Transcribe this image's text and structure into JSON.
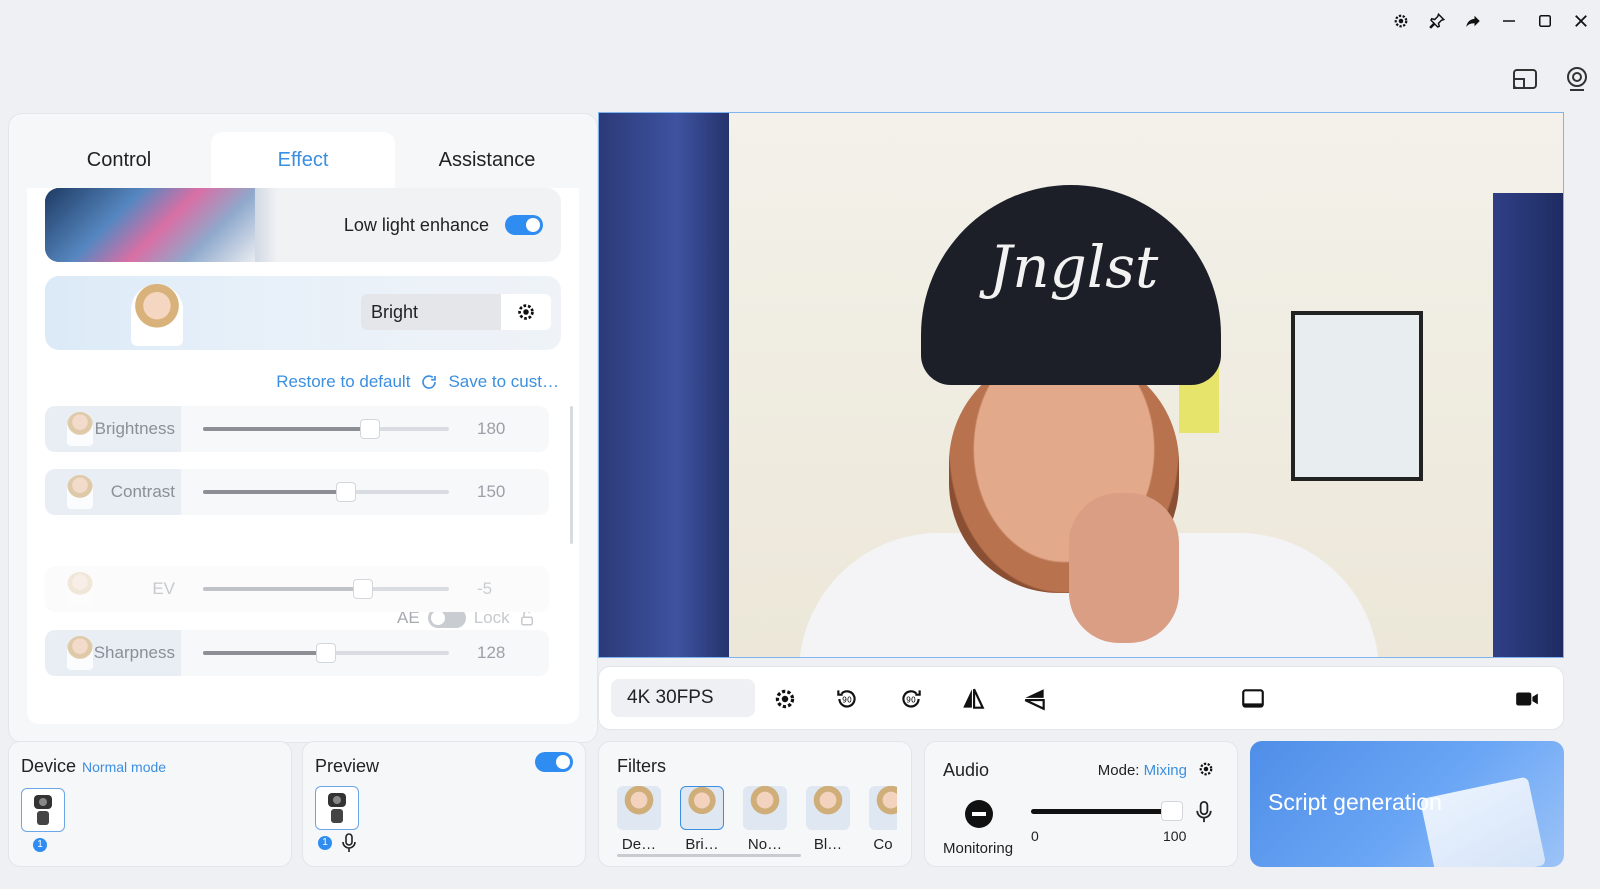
{
  "window": {
    "controls": [
      "gear-icon",
      "pin-icon",
      "share-icon",
      "minimize-icon",
      "maximize-icon",
      "close-icon"
    ]
  },
  "tabs": [
    {
      "label": "Control",
      "active": false
    },
    {
      "label": "Effect",
      "active": true
    },
    {
      "label": "Assistance",
      "active": false
    }
  ],
  "effect": {
    "low_light_label": "Low light enhance",
    "low_light_on": true,
    "style_value": "Bright",
    "restore_label": "Restore to default",
    "save_label": "Save to cust…",
    "sliders": [
      {
        "label": "Brightness",
        "value": "180",
        "fraction": 0.68,
        "faded": false
      },
      {
        "label": "Contrast",
        "value": "150",
        "fraction": 0.58,
        "faded": false
      },
      {
        "label": "EV",
        "value": "-5",
        "fraction": 0.65,
        "faded": true
      },
      {
        "label": "Sharpness",
        "value": "128",
        "fraction": 0.5,
        "faded": false
      }
    ],
    "ae_label": "AE",
    "lock_label": "Lock"
  },
  "video": {
    "hat_text": "Jnglst"
  },
  "camera_bar": {
    "resolution": "4K 30FPS"
  },
  "device": {
    "title": "Device",
    "mode": "Normal mode",
    "badge": "1"
  },
  "preview": {
    "title": "Preview",
    "enabled": true,
    "badge": "1"
  },
  "filters": {
    "title": "Filters",
    "items": [
      {
        "label": "De…",
        "selected": false
      },
      {
        "label": "Bri…",
        "selected": true
      },
      {
        "label": "No…",
        "selected": false
      },
      {
        "label": "Bl…",
        "selected": false
      },
      {
        "label": "Co",
        "selected": false
      }
    ]
  },
  "audio": {
    "title": "Audio",
    "mode_label": "Mode:",
    "mode_value": "Mixing",
    "monitoring_label": "Monitoring",
    "min": "0",
    "max": "100",
    "level_fraction": 0.95
  },
  "script": {
    "label": "Script generation"
  },
  "colors": {
    "accent": "#3b8fe0",
    "toggle_on": "#2f8cf0"
  }
}
